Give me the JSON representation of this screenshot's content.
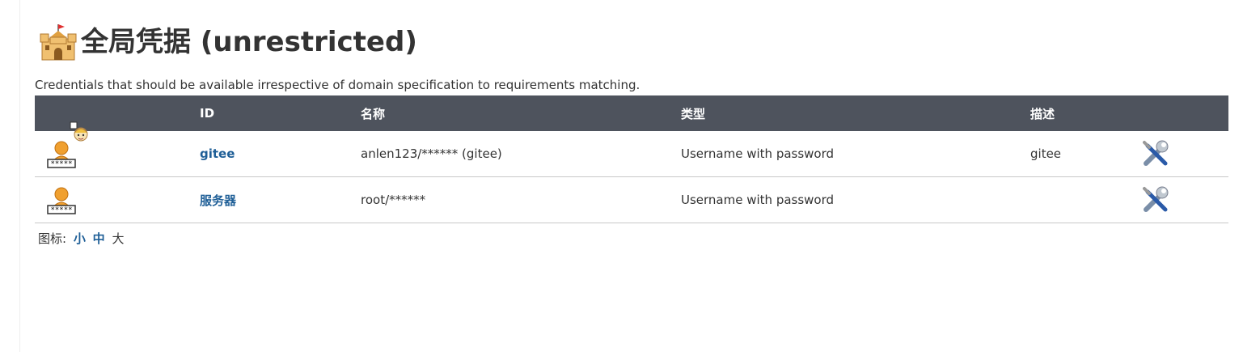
{
  "page": {
    "title": "全局凭据 (unrestricted)",
    "description": "Credentials that should be available irrespective of domain specification to requirements matching."
  },
  "table": {
    "headers": {
      "icon": "",
      "id": "ID",
      "name": "名称",
      "type": "类型",
      "desc": "描述"
    },
    "rows": [
      {
        "id": "gitee",
        "name": "anlen123/****** (gitee)",
        "type": "Username with password",
        "desc": "gitee"
      },
      {
        "id": "服务器",
        "name": "root/******",
        "type": "Username with password",
        "desc": ""
      }
    ]
  },
  "icon_size": {
    "label": "图标:",
    "small": "小",
    "medium": "中",
    "large": "大"
  },
  "colors": {
    "header_bg": "#4e535d",
    "link": "#1f5f97"
  }
}
